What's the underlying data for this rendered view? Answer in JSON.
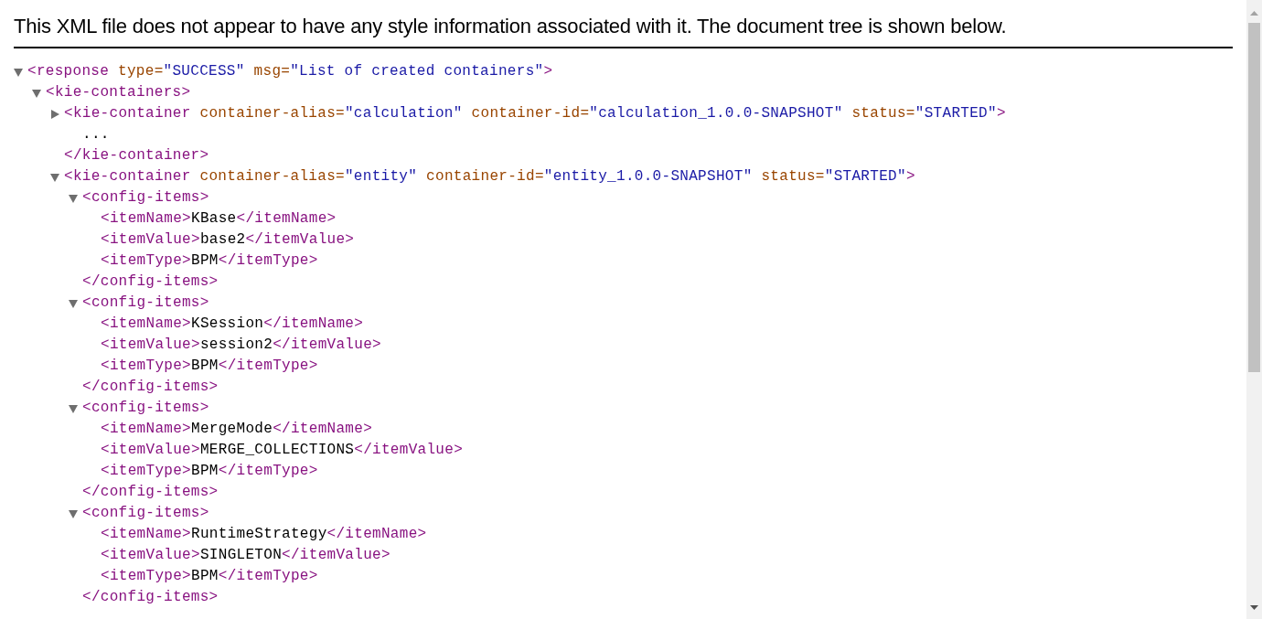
{
  "header": "This XML file does not appear to have any style information associated with it. The document tree is shown below.",
  "tree": [
    {
      "expanded": true,
      "open": [
        {
          "kind": "tag",
          "text": "<response"
        },
        {
          "kind": "attr",
          "text": " type="
        },
        {
          "kind": "value",
          "text": "\"SUCCESS\""
        },
        {
          "kind": "attr",
          "text": " msg="
        },
        {
          "kind": "value",
          "text": "\"List of created containers\""
        },
        {
          "kind": "tag",
          "text": ">"
        }
      ],
      "children": [
        {
          "expanded": true,
          "open": [
            {
              "kind": "tag",
              "text": "<kie-containers>"
            }
          ],
          "children": [
            {
              "expanded": false,
              "open": [
                {
                  "kind": "tag",
                  "text": "<kie-container"
                },
                {
                  "kind": "attr",
                  "text": " container-alias="
                },
                {
                  "kind": "value",
                  "text": "\"calculation\""
                },
                {
                  "kind": "attr",
                  "text": " container-id="
                },
                {
                  "kind": "value",
                  "text": "\"calculation_1.0.0-SNAPSHOT\""
                },
                {
                  "kind": "attr",
                  "text": " status="
                },
                {
                  "kind": "value",
                  "text": "\"STARTED\""
                },
                {
                  "kind": "tag",
                  "text": ">"
                }
              ],
              "children": [
                {
                  "line": [
                    {
                      "text": "..."
                    }
                  ]
                }
              ],
              "close": [
                {
                  "kind": "tag",
                  "text": "</kie-container>"
                }
              ]
            },
            {
              "expanded": true,
              "open": [
                {
                  "kind": "tag",
                  "text": "<kie-container"
                },
                {
                  "kind": "attr",
                  "text": " container-alias="
                },
                {
                  "kind": "value",
                  "text": "\"entity\""
                },
                {
                  "kind": "attr",
                  "text": " container-id="
                },
                {
                  "kind": "value",
                  "text": "\"entity_1.0.0-SNAPSHOT\""
                },
                {
                  "kind": "attr",
                  "text": " status="
                },
                {
                  "kind": "value",
                  "text": "\"STARTED\""
                },
                {
                  "kind": "tag",
                  "text": ">"
                }
              ],
              "children": [
                {
                  "expanded": true,
                  "open": [
                    {
                      "kind": "tag",
                      "text": "<config-items>"
                    }
                  ],
                  "children": [
                    {
                      "line": [
                        {
                          "kind": "tag",
                          "text": "<itemName>"
                        },
                        {
                          "kind": "text",
                          "text": "KBase"
                        },
                        {
                          "kind": "tag",
                          "text": "</itemName>"
                        }
                      ]
                    },
                    {
                      "line": [
                        {
                          "kind": "tag",
                          "text": "<itemValue>"
                        },
                        {
                          "kind": "text",
                          "text": "base2"
                        },
                        {
                          "kind": "tag",
                          "text": "</itemValue>"
                        }
                      ]
                    },
                    {
                      "line": [
                        {
                          "kind": "tag",
                          "text": "<itemType>"
                        },
                        {
                          "kind": "text",
                          "text": "BPM"
                        },
                        {
                          "kind": "tag",
                          "text": "</itemType>"
                        }
                      ]
                    }
                  ],
                  "close": [
                    {
                      "kind": "tag",
                      "text": "</config-items>"
                    }
                  ]
                },
                {
                  "expanded": true,
                  "open": [
                    {
                      "kind": "tag",
                      "text": "<config-items>"
                    }
                  ],
                  "children": [
                    {
                      "line": [
                        {
                          "kind": "tag",
                          "text": "<itemName>"
                        },
                        {
                          "kind": "text",
                          "text": "KSession"
                        },
                        {
                          "kind": "tag",
                          "text": "</itemName>"
                        }
                      ]
                    },
                    {
                      "line": [
                        {
                          "kind": "tag",
                          "text": "<itemValue>"
                        },
                        {
                          "kind": "text",
                          "text": "session2"
                        },
                        {
                          "kind": "tag",
                          "text": "</itemValue>"
                        }
                      ]
                    },
                    {
                      "line": [
                        {
                          "kind": "tag",
                          "text": "<itemType>"
                        },
                        {
                          "kind": "text",
                          "text": "BPM"
                        },
                        {
                          "kind": "tag",
                          "text": "</itemType>"
                        }
                      ]
                    }
                  ],
                  "close": [
                    {
                      "kind": "tag",
                      "text": "</config-items>"
                    }
                  ]
                },
                {
                  "expanded": true,
                  "open": [
                    {
                      "kind": "tag",
                      "text": "<config-items>"
                    }
                  ],
                  "children": [
                    {
                      "line": [
                        {
                          "kind": "tag",
                          "text": "<itemName>"
                        },
                        {
                          "kind": "text",
                          "text": "MergeMode"
                        },
                        {
                          "kind": "tag",
                          "text": "</itemName>"
                        }
                      ]
                    },
                    {
                      "line": [
                        {
                          "kind": "tag",
                          "text": "<itemValue>"
                        },
                        {
                          "kind": "text",
                          "text": "MERGE_COLLECTIONS"
                        },
                        {
                          "kind": "tag",
                          "text": "</itemValue>"
                        }
                      ]
                    },
                    {
                      "line": [
                        {
                          "kind": "tag",
                          "text": "<itemType>"
                        },
                        {
                          "kind": "text",
                          "text": "BPM"
                        },
                        {
                          "kind": "tag",
                          "text": "</itemType>"
                        }
                      ]
                    }
                  ],
                  "close": [
                    {
                      "kind": "tag",
                      "text": "</config-items>"
                    }
                  ]
                },
                {
                  "expanded": true,
                  "open": [
                    {
                      "kind": "tag",
                      "text": "<config-items>"
                    }
                  ],
                  "children": [
                    {
                      "line": [
                        {
                          "kind": "tag",
                          "text": "<itemName>"
                        },
                        {
                          "kind": "text",
                          "text": "RuntimeStrategy"
                        },
                        {
                          "kind": "tag",
                          "text": "</itemName>"
                        }
                      ]
                    },
                    {
                      "line": [
                        {
                          "kind": "tag",
                          "text": "<itemValue>"
                        },
                        {
                          "kind": "text",
                          "text": "SINGLETON"
                        },
                        {
                          "kind": "tag",
                          "text": "</itemValue>"
                        }
                      ]
                    },
                    {
                      "line": [
                        {
                          "kind": "tag",
                          "text": "<itemType>"
                        },
                        {
                          "kind": "text",
                          "text": "BPM"
                        },
                        {
                          "kind": "tag",
                          "text": "</itemType>"
                        }
                      ]
                    }
                  ],
                  "close": [
                    {
                      "kind": "tag",
                      "text": "</config-items>"
                    }
                  ]
                }
              ]
            }
          ]
        }
      ]
    }
  ]
}
